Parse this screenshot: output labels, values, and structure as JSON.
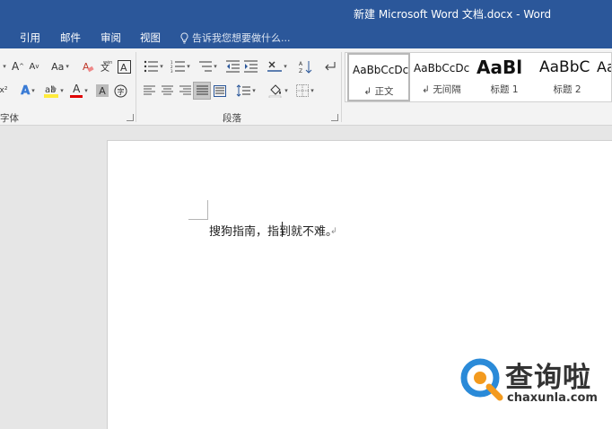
{
  "window": {
    "title": "新建 Microsoft Word 文档.docx - Word"
  },
  "tabs": [
    "引用",
    "邮件",
    "审阅",
    "视图"
  ],
  "tell_me": "告诉我您想要做什么...",
  "ribbon": {
    "font_group": {
      "label": "字体",
      "buttons": [
        "A",
        "A",
        "Aa",
        "A",
        "A",
        "A",
        "A"
      ]
    },
    "paragraph_group": {
      "label": "段落"
    },
    "styles": [
      {
        "preview": "AaBbCcDc",
        "name": "正文",
        "selected": true
      },
      {
        "preview": "AaBbCcDc",
        "name": "无间隔",
        "selected": false
      },
      {
        "preview": "AaBl",
        "name": "标题 1",
        "selected": false
      },
      {
        "preview": "AaBbC",
        "name": "标题 2",
        "selected": false
      },
      {
        "preview": "Aa",
        "name": "",
        "selected": false
      }
    ]
  },
  "document": {
    "text": "搜狗指南，指到就不难。"
  },
  "watermark": {
    "name": "查询啦",
    "url": "chaxunla.com"
  },
  "colors": {
    "accent": "#2b579a",
    "highlight_yellow": "#ffeb3b",
    "font_red": "#e00000",
    "logo_blue": "#2a8ad8",
    "logo_orange": "#f39a1e"
  }
}
